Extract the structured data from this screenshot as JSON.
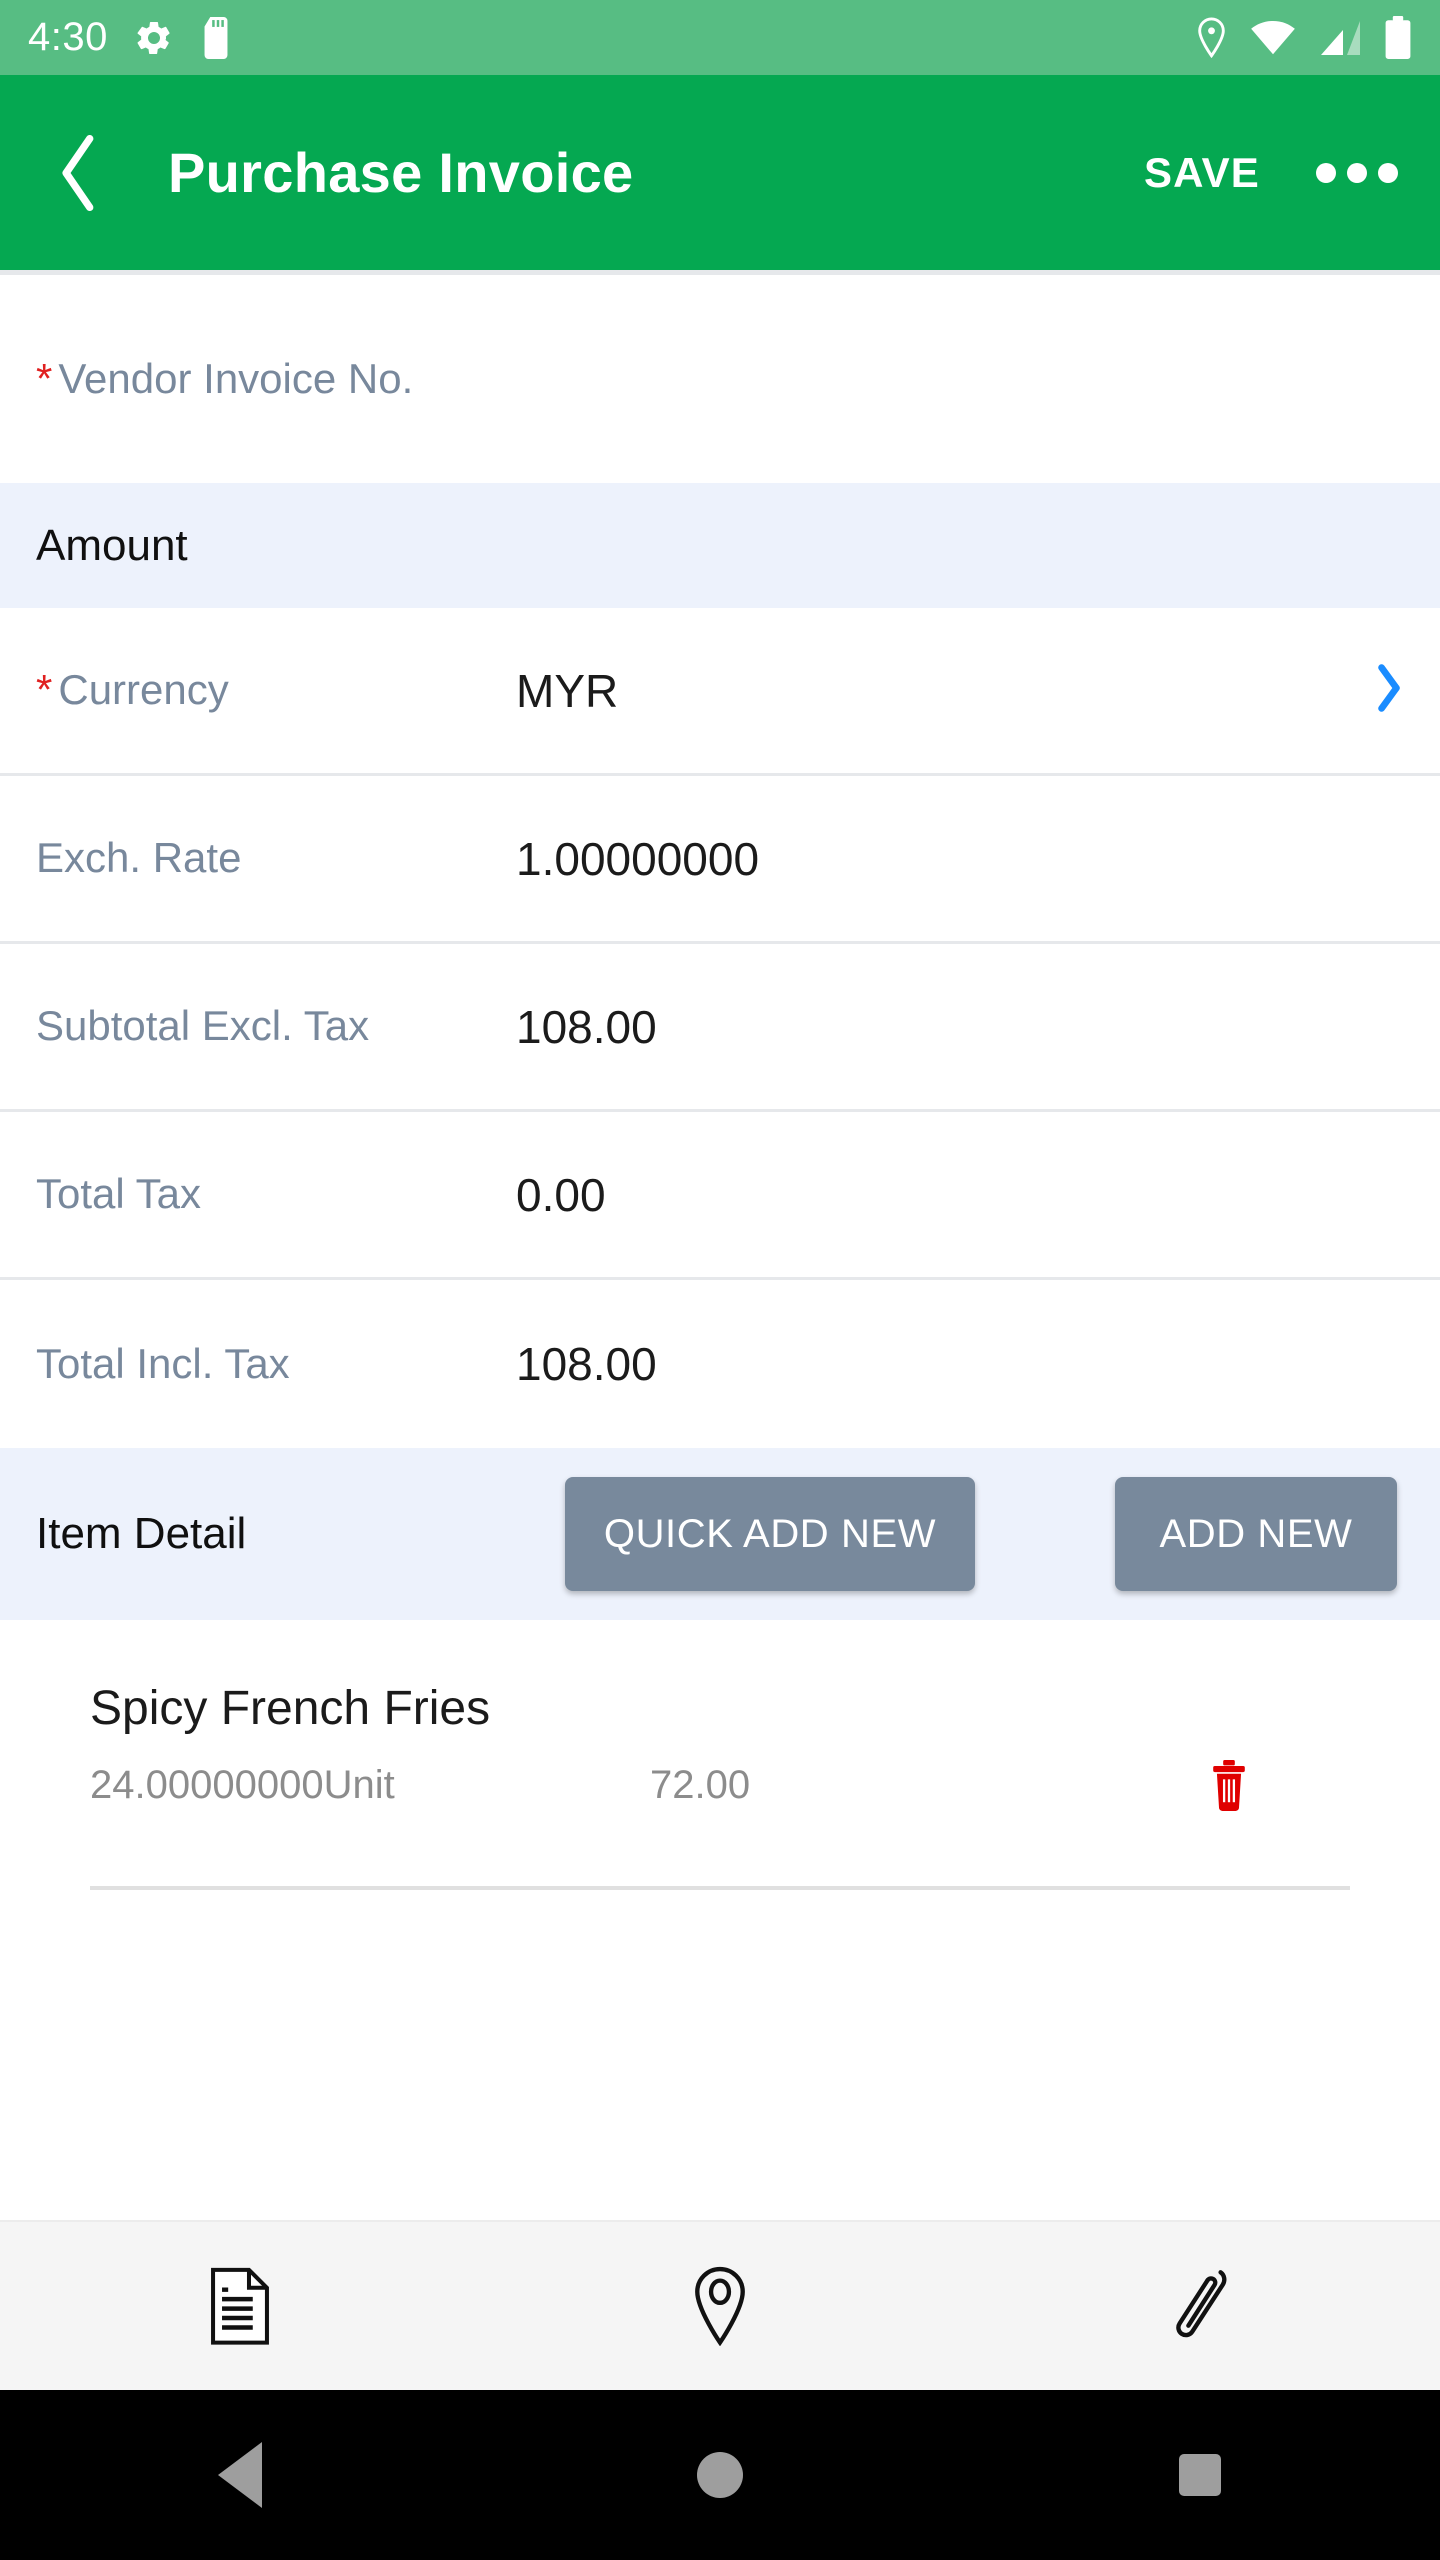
{
  "status_bar": {
    "time": "4:30",
    "left_icons": [
      "settings-gear-icon",
      "sd-card-icon"
    ],
    "right_icons": [
      "location-pin-icon",
      "wifi-icon",
      "cellular-signal-icon",
      "battery-icon"
    ],
    "background_color": "#57bd83"
  },
  "app_bar": {
    "back_label": "back-arrow",
    "title": "Purchase Invoice",
    "save_label": "SAVE",
    "overflow_label": "more-options",
    "background_color": "#05a851"
  },
  "form": {
    "vendor_invoice": {
      "required_mark": "*",
      "label": "Vendor Invoice No.",
      "value": ""
    },
    "amount_section": {
      "title": "Amount",
      "background_color": "#edf2fc"
    },
    "rows": [
      {
        "required_mark": "*",
        "label": "Currency",
        "value": "MYR",
        "has_chevron": true,
        "chevron_color": "#1a8cff"
      },
      {
        "required_mark": "",
        "label": "Exch. Rate",
        "value": "1.00000000",
        "has_chevron": false
      },
      {
        "required_mark": "",
        "label": "Subtotal Excl. Tax",
        "value": "108.00",
        "has_chevron": false
      },
      {
        "required_mark": "",
        "label": "Total Tax",
        "value": "0.00",
        "has_chevron": false
      },
      {
        "required_mark": "",
        "label": "Total Incl. Tax",
        "value": "108.00",
        "has_chevron": false
      }
    ]
  },
  "item_detail": {
    "title": "Item Detail",
    "quick_add_label": "QUICK ADD NEW",
    "add_new_label": "ADD NEW",
    "button_color": "#78899c",
    "items": [
      {
        "name": "Spicy French Fries",
        "quantity": "24.00000000Unit",
        "amount": "72.00",
        "delete_icon": "trash-icon",
        "delete_icon_color": "#e00000"
      }
    ]
  },
  "bottom_toolbar": {
    "items": [
      {
        "icon": "document-note-icon",
        "label": ""
      },
      {
        "icon": "location-pin-icon",
        "label": ""
      },
      {
        "icon": "attachment-paperclip-icon",
        "label": ""
      }
    ],
    "background_color": "#f5f5f5"
  },
  "nav_bar": {
    "items": [
      {
        "icon": "triangle-back-icon"
      },
      {
        "icon": "circle-home-icon"
      },
      {
        "icon": "square-recents-icon"
      }
    ],
    "background_color": "#000000"
  },
  "theme": {
    "label_color": "#78889c",
    "value_color": "#1b1b1b",
    "required_color": "#e02020",
    "divider_color": "#e6e8eb"
  }
}
